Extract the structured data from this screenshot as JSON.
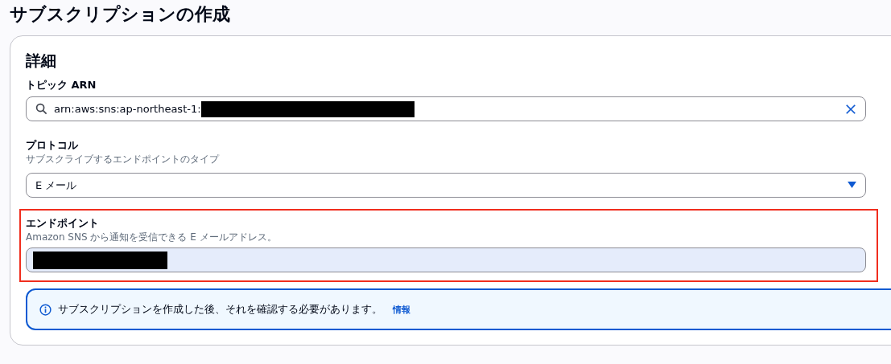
{
  "page_title": "サブスクリプションの作成",
  "card": {
    "title": "詳細",
    "topic_field": {
      "label": "トピック ARN",
      "value": "arn:aws:sns:ap-northeast-1:",
      "redacted": true
    },
    "protocol_field": {
      "label": "プロトコル",
      "description": "サブスクライブするエンドポイントのタイプ",
      "value": "E メール"
    },
    "endpoint_field": {
      "label": "エンドポイント",
      "description": "Amazon SNS から通知を受信できる E メールアドレス。",
      "redacted": true,
      "highlighted": true
    },
    "info_alert": {
      "message": "サブスクリプションを作成した後、それを確認する必要があります。",
      "link": "情報"
    }
  }
}
